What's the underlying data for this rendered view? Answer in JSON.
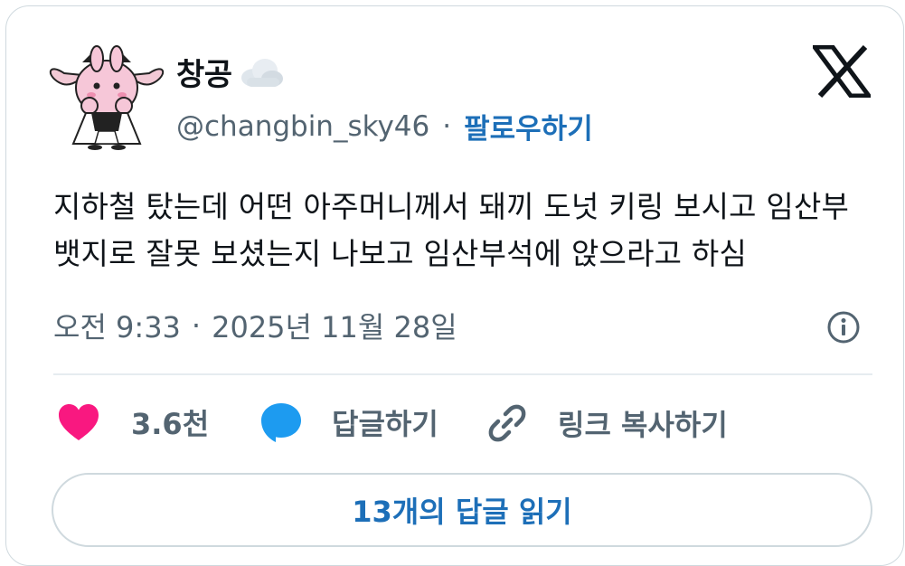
{
  "author": {
    "display_name": "창공",
    "handle": "@changbin_sky46",
    "follow_label": "팔로우하기",
    "avatar_icon": "bunny-character-avatar",
    "name_emoji_icon": "cloud-emoji-icon"
  },
  "platform_icon": "x-logo-icon",
  "post": {
    "lines": [
      "지하철 탔는데 어떤 아주머니께서 돼끼 도넛 키링 보시고 임산부",
      "뱃지로 잘못 보셨는지 나보고 임산부석에 앉으라고 하심"
    ],
    "time": "오전 9:33",
    "date": "2025년 11월 28일"
  },
  "actions": {
    "like_count": "3.6천",
    "reply_label": "답글하기",
    "copy_link_label": "링크 복사하기"
  },
  "read_replies_label": "13개의 답글 읽기",
  "colors": {
    "like": "#f91880",
    "reply": "#1d9bf0",
    "link": "#1d6fb8",
    "muted": "#536471",
    "text": "#0f1419"
  }
}
